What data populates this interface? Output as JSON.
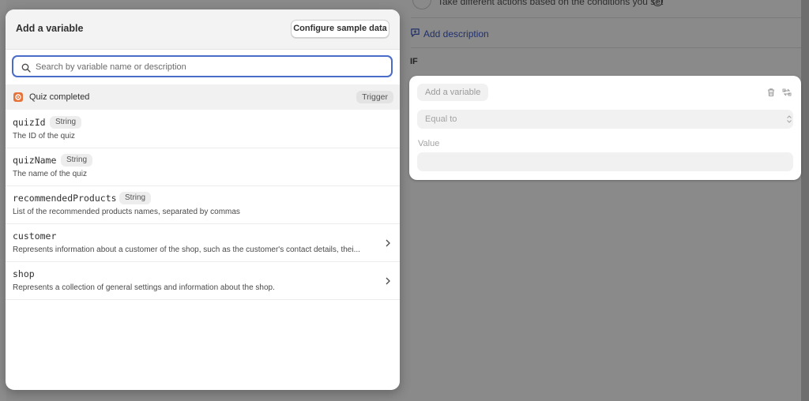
{
  "background": {
    "condition_description": "Take different actions based on the conditions you set",
    "add_description_label": "Add description",
    "if_label": "IF",
    "condition": {
      "add_variable_label": "Add a variable",
      "operator_value": "Equal to",
      "value_label": "Value",
      "value_input": ""
    }
  },
  "modal": {
    "title": "Add a variable",
    "configure_button": "Configure sample data",
    "search": {
      "placeholder": "Search by variable name or description",
      "value": ""
    },
    "trigger": {
      "label": "Quiz completed",
      "badge": "Trigger"
    },
    "variables": [
      {
        "name": "quizId",
        "type": "String",
        "description": "The ID of the quiz",
        "expandable": false
      },
      {
        "name": "quizName",
        "type": "String",
        "description": "The name of the quiz",
        "expandable": false
      },
      {
        "name": "recommendedProducts",
        "type": "String",
        "description": "List of the recommended products names, separated by commas",
        "expandable": false
      },
      {
        "name": "customer",
        "type": "",
        "description": "Represents information about a customer of the shop, such as the customer's contact details, thei...",
        "expandable": true
      },
      {
        "name": "shop",
        "type": "",
        "description": "Represents a collection of general settings and information about the shop.",
        "expandable": true
      }
    ]
  },
  "colors": {
    "focus_ring": "#4a6cc9",
    "link": "#20306b",
    "trigger_icon": "#e8733a"
  }
}
